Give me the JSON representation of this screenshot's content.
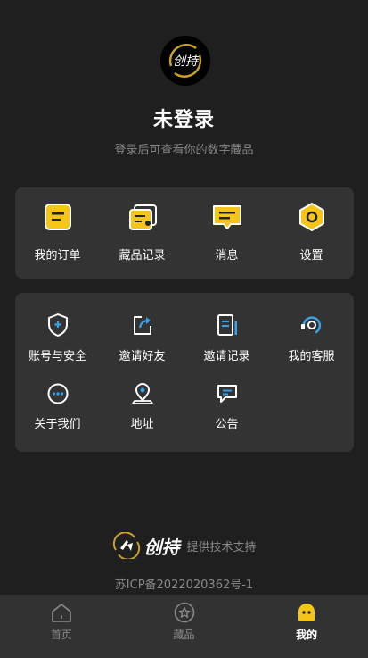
{
  "header": {
    "avatar_logo_text": "创持",
    "title": "未登录",
    "subtitle": "登录后可查看你的数字藏品"
  },
  "quick_menu": [
    {
      "label": "我的订单",
      "icon": "order-icon"
    },
    {
      "label": "藏品记录",
      "icon": "collection-record-icon"
    },
    {
      "label": "消息",
      "icon": "message-icon"
    },
    {
      "label": "设置",
      "icon": "settings-icon"
    }
  ],
  "service_menu": [
    {
      "label": "账号与安全",
      "icon": "shield-icon"
    },
    {
      "label": "邀请好友",
      "icon": "share-icon"
    },
    {
      "label": "邀请记录",
      "icon": "document-icon"
    },
    {
      "label": "我的客服",
      "icon": "customer-service-icon"
    },
    {
      "label": "关于我们",
      "icon": "more-dots-icon"
    },
    {
      "label": "地址",
      "icon": "location-icon"
    },
    {
      "label": "公告",
      "icon": "announcement-icon"
    }
  ],
  "footer": {
    "brand_name": "创持",
    "support_text": "提供技术支持",
    "icp": "苏ICP备2022020362号-1"
  },
  "tabbar": [
    {
      "label": "首页",
      "icon": "home-icon",
      "active": false
    },
    {
      "label": "藏品",
      "icon": "star-icon",
      "active": false
    },
    {
      "label": "我的",
      "icon": "profile-icon",
      "active": true
    }
  ],
  "colors": {
    "background": "#1f1f1f",
    "card": "#333333",
    "accent_yellow": "#f5c518",
    "accent_blue": "#3aa0e6",
    "muted_text": "#8a8a8a",
    "tabbar": "#323232"
  }
}
